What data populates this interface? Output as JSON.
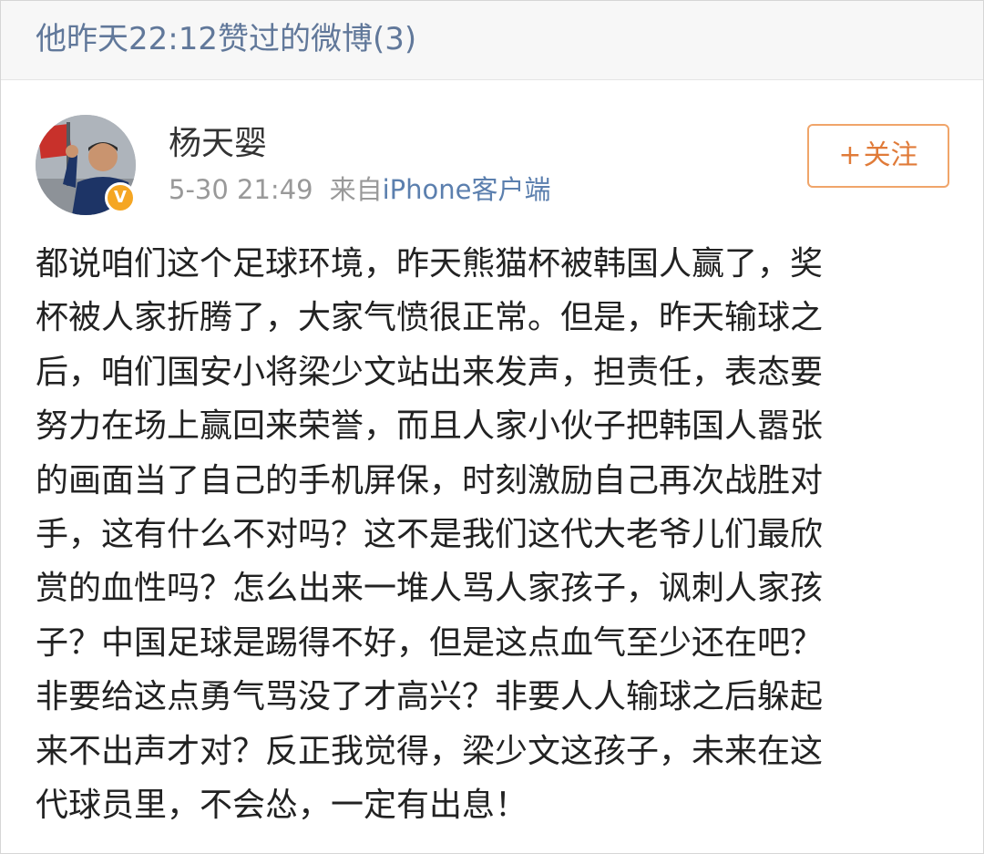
{
  "section": {
    "title": "他昨天22:12赞过的微博(3)"
  },
  "post": {
    "author": {
      "name": "杨天婴",
      "verified_mark": "V"
    },
    "timestamp": "5-30 21:49",
    "source_prefix": "来自",
    "source": "iPhone客户端",
    "follow": {
      "plus": "+",
      "label": "关注"
    },
    "body_lines": [
      "都说咱们这个足球环境，昨天熊猫杯被韩国人赢了，奖",
      "杯被人家折腾了，大家气愤很正常。但是，昨天输球之",
      "后，咱们国安小将梁少文站出来发声，担责任，表态要",
      "努力在场上赢回来荣誉，而且人家小伙子把韩国人嚣张",
      "的画面当了自己的手机屏保，时刻激励自己再次战胜对",
      "手，这有什么不对吗？这不是我们这代大老爷儿们最欣",
      "赏的血性吗？怎么出来一堆人骂人家孩子，讽刺人家孩",
      "子？中国足球是踢得不好，但是这点血气至少还在吧？",
      "非要给这点勇气骂没了才高兴？非要人人输球之后躲起",
      "来不出声才对？反正我觉得，梁少文这孩子，未来在这",
      "代球员里，不会怂，一定有出息！"
    ]
  },
  "colors": {
    "header_text": "#61789a",
    "link": "#5b7fae",
    "follow_accent": "#e07b39",
    "verified_badge": "#f5a623"
  },
  "icons": {
    "avatar": "user-avatar-photo",
    "verified": "verified-badge-icon"
  }
}
